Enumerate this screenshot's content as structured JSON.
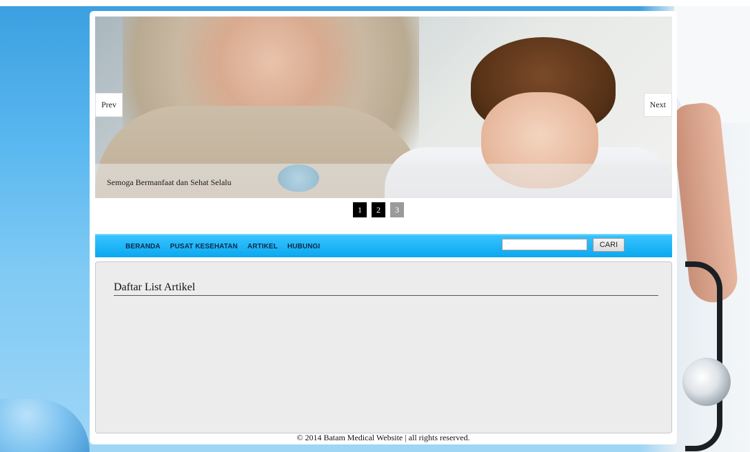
{
  "slider": {
    "prev_label": "Prev",
    "next_label": "Next",
    "caption": "Semoga Bermanfaat dan Sehat Selalu",
    "pages": [
      "1",
      "2",
      "3"
    ]
  },
  "nav": {
    "items": [
      "BERANDA",
      "PUSAT KESEHATAN",
      "ARTIKEL",
      "HUBUNGI"
    ],
    "search_value": "",
    "search_button": "CARI"
  },
  "content": {
    "title": "Daftar List Artikel"
  },
  "footer": {
    "text": "© 2014 Batam Medical Website | all rights reserved."
  },
  "colors": {
    "navbar": "#0ba8ef",
    "pager_active": "#000000",
    "pager_inactive": "#9a9a9a"
  }
}
